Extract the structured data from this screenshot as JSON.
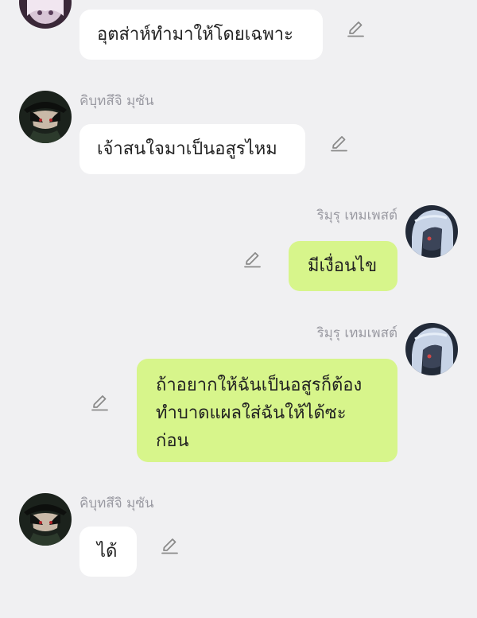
{
  "conversation": {
    "messages": [
      {
        "side": "left",
        "sender": "",
        "text": "อุตส่าห์ทำมาให้โดยเฉพาะ",
        "avatar_icon": "avatar-anime-girl-pink"
      },
      {
        "side": "left",
        "sender": "คิบุทสึจิ มุซัน",
        "text": "เจ้าสนใจมาเป็นอสูรไหม",
        "avatar_icon": "avatar-anime-man-hat"
      },
      {
        "side": "right",
        "sender": "ริมุรุ เทมเพสต์",
        "text": "มีเงื่อนไข",
        "avatar_icon": "avatar-anime-silver-hair"
      },
      {
        "side": "right",
        "sender": "ริมุรุ เทมเพสต์",
        "text_lines": [
          "ถ้าอยากให้ฉันเป็นอสูรก็ต้อง",
          "ทำบาดแผลใส่ฉันให้ได้ซะ",
          "ก่อน"
        ],
        "avatar_icon": "avatar-anime-silver-hair"
      },
      {
        "side": "left",
        "sender": "คิบุทสึจิ มุซัน",
        "text": "ได้",
        "avatar_icon": "avatar-anime-man-hat"
      }
    ]
  },
  "icons": {
    "edit": "pencil-icon"
  },
  "colors": {
    "background": "#f0f0f2",
    "incoming_bubble": "#ffffff",
    "outgoing_bubble": "#d7f58b",
    "sender_name": "#9a9aa2",
    "message_text": "#222222",
    "pencil": "#8a8a8a"
  }
}
